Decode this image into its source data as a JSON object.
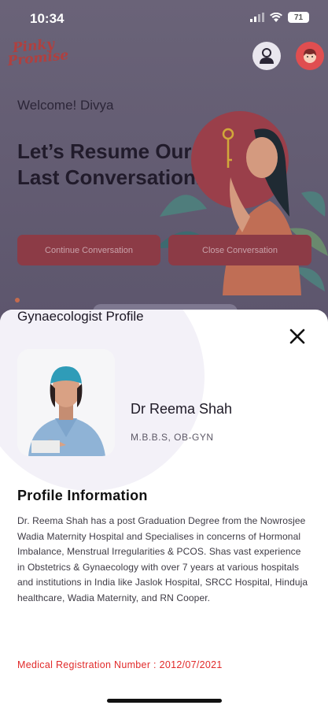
{
  "status_bar": {
    "time": "10:34",
    "battery": "71"
  },
  "header": {
    "logo_text_line1": "Pinky",
    "logo_text_line2": "Promise"
  },
  "hero": {
    "welcome": "Welcome! Divya",
    "title": "Let’s Resume Our Last Conversation.",
    "continue_label": "Continue Conversation",
    "close_label": "Close Conversation"
  },
  "sheet": {
    "title": "Gynaecologist Profile",
    "doctor_name": "Dr Reema Shah",
    "qualification": "M.B.B.S, OB-GYN",
    "section_title": "Profile Information",
    "bio": "Dr. Reema Shah has a post Graduation Degree from the Nowrosjee Wadia Maternity Hospital and Specialises in concerns of Hormonal Imbalance, Menstrual Irregularities & PCOS.  Shas vast experience in Obstetrics & Gynaecology with over 7 years at various hospitals and institutions in India like Jaslok Hospital, SRCC Hospital, Hinduja healthcare, Wadia Maternity, and RN Cooper.",
    "registration": "Medical Registration Number : 2012/07/2021"
  },
  "colors": {
    "accent": "#e12a2a",
    "button": "#8c3b46",
    "overlay": "#5f5870"
  }
}
